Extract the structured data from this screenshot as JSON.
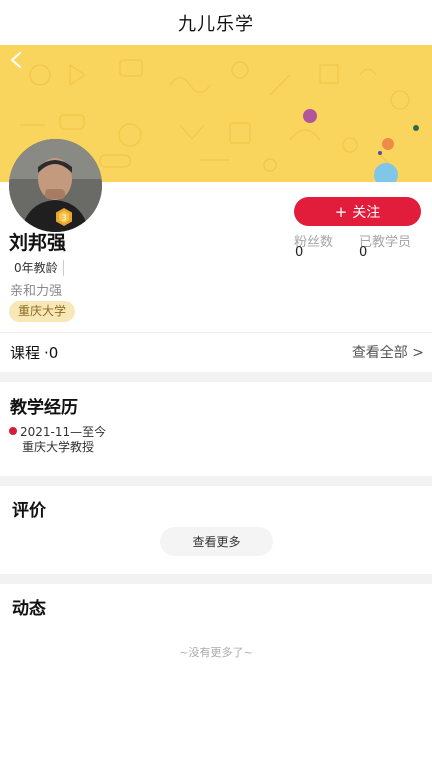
{
  "app": {
    "title": "九儿乐学"
  },
  "colors": {
    "banner": "#f9d55d",
    "accent_red": "#e21d3c",
    "tag_bg": "#f8e8b8"
  },
  "nav": {
    "back_icon": "chevron-left-icon"
  },
  "profile": {
    "name": "刘邦强",
    "teach_years": "0年教龄",
    "tagline": "亲和力强",
    "school_tag": "重庆大学",
    "badge_icon": "medal-icon"
  },
  "follow": {
    "plus": "+",
    "label": "关注"
  },
  "stats": [
    {
      "label": "粉丝数",
      "value": "0"
    },
    {
      "label": "已教学员",
      "value": "0"
    }
  ],
  "courses": {
    "label": "课程",
    "count": "·0",
    "see_all": "查看全部 >"
  },
  "experience": {
    "title": "教学经历",
    "items": [
      {
        "date": "2021-11—至今",
        "role": "重庆大学教授"
      }
    ]
  },
  "reviews": {
    "title": "评价",
    "more": "查看更多"
  },
  "moments": {
    "title": "动态",
    "empty": "~没有更多了~"
  }
}
